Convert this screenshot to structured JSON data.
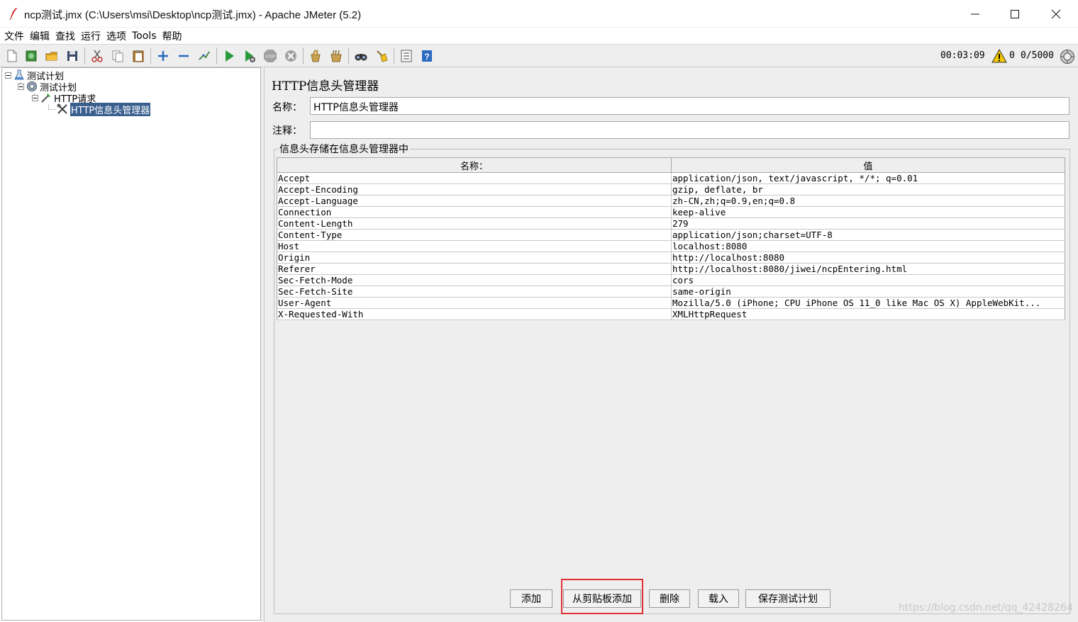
{
  "window": {
    "title": "ncp测试.jmx (C:\\Users\\msi\\Desktop\\ncp测试.jmx) - Apache JMeter (5.2)"
  },
  "menu": [
    "文件",
    "编辑",
    "查找",
    "运行",
    "选项",
    "Tools",
    "帮助"
  ],
  "toolbar": {
    "icons": [
      "new-icon",
      "templates-icon",
      "open-icon",
      "save-icon",
      "cut-icon",
      "copy-icon",
      "paste-icon",
      "expand-icon",
      "collapse-icon",
      "toggle-icon",
      "start-icon",
      "start-no-pause-icon",
      "stop-icon",
      "shutdown-icon",
      "clear-icon",
      "clear-all-icon",
      "search-icon",
      "reset-search-icon",
      "function-helper-icon",
      "help-icon"
    ],
    "elapsed_time": "00:03:09",
    "warning_count": "0",
    "threads": "0/5000"
  },
  "tree": {
    "nodes": [
      {
        "label": "测试计划",
        "icon": "test-plan-icon"
      },
      {
        "label": "测试计划",
        "icon": "thread-group-icon"
      },
      {
        "label": "HTTP请求",
        "icon": "sampler-icon"
      },
      {
        "label": "HTTP信息头管理器",
        "icon": "config-element-icon",
        "selected": true
      }
    ]
  },
  "panel": {
    "title": "HTTP信息头管理器",
    "name_label": "名称：",
    "name_value": "HTTP信息头管理器",
    "comment_label": "注释：",
    "comment_value": "",
    "group_title": "信息头存储在信息头管理器中"
  },
  "table": {
    "headers": [
      "名称：",
      "值"
    ],
    "rows": [
      {
        "name": "Accept",
        "value": "application/json, text/javascript, */*; q=0.01"
      },
      {
        "name": "Accept-Encoding",
        "value": "gzip, deflate, br"
      },
      {
        "name": "Accept-Language",
        "value": "zh-CN,zh;q=0.9,en;q=0.8"
      },
      {
        "name": "Connection",
        "value": "keep-alive"
      },
      {
        "name": "Content-Length",
        "value": "279"
      },
      {
        "name": "Content-Type",
        "value": "application/json;charset=UTF-8"
      },
      {
        "name": "Host",
        "value": "localhost:8080"
      },
      {
        "name": "Origin",
        "value": "http://localhost:8080"
      },
      {
        "name": "Referer",
        "value": "http://localhost:8080/jiwei/ncpEntering.html"
      },
      {
        "name": "Sec-Fetch-Mode",
        "value": "cors"
      },
      {
        "name": "Sec-Fetch-Site",
        "value": "same-origin"
      },
      {
        "name": "User-Agent",
        "value": "Mozilla/5.0 (iPhone; CPU iPhone OS 11_0 like Mac OS X) AppleWebKit..."
      },
      {
        "name": "X-Requested-With",
        "value": "XMLHttpRequest"
      }
    ]
  },
  "buttons": {
    "add": "添加",
    "add_from_clipboard": "从剪贴板添加",
    "delete": "删除",
    "load": "载入",
    "save_test_plan": "保存测试计划"
  },
  "watermark": "https://blog.csdn.net/qq_42428264",
  "colors": {
    "selection": "#3a5f8f",
    "highlight": "#e03030",
    "panel_bg": "#eeeeee"
  }
}
